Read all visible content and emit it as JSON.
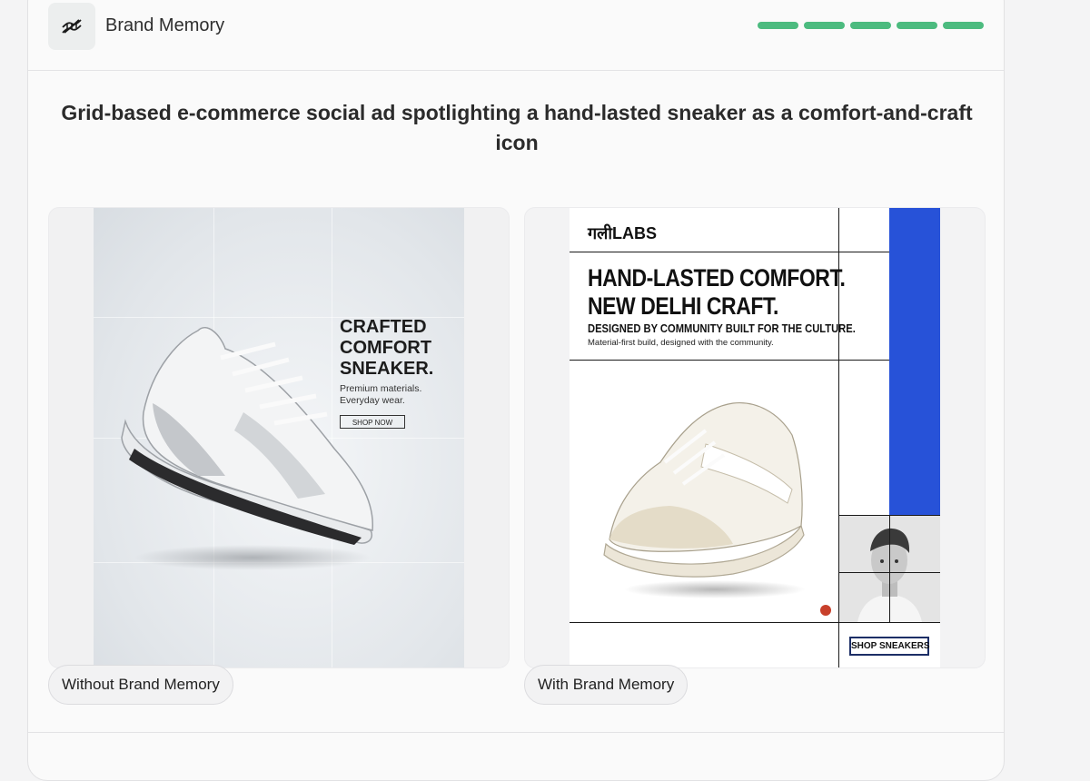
{
  "header": {
    "title": "Brand Memory",
    "logo_icon": "dna-icon",
    "progress_color": "#4cbb7f",
    "progress_total": 5,
    "progress_completed": 5
  },
  "headline": "Grid-based e-commerce social ad spotlighting a hand-lasted sneaker as a comfort-and-craft icon",
  "panels": [
    {
      "label": "Without Brand Memory",
      "ad": {
        "headline": "CRAFTED\nCOMFORT\nSNEAKER.",
        "subtext": "Premium materials.\nEveryday wear.",
        "cta": "SHOP NOW"
      }
    },
    {
      "label": "With Brand Memory",
      "ad": {
        "logo": "गलीLABS",
        "headline": "HAND-LASTED COMFORT.\nNEW DELHI CRAFT.",
        "subhead": "DESIGNED BY COMMUNITY BUILT FOR THE CULTURE.",
        "body": "Material-first build, designed with the community.",
        "cta": "SHOP SNEAKERS",
        "accent_color": "#2752d8",
        "dot_color": "#c8402b"
      }
    }
  ]
}
